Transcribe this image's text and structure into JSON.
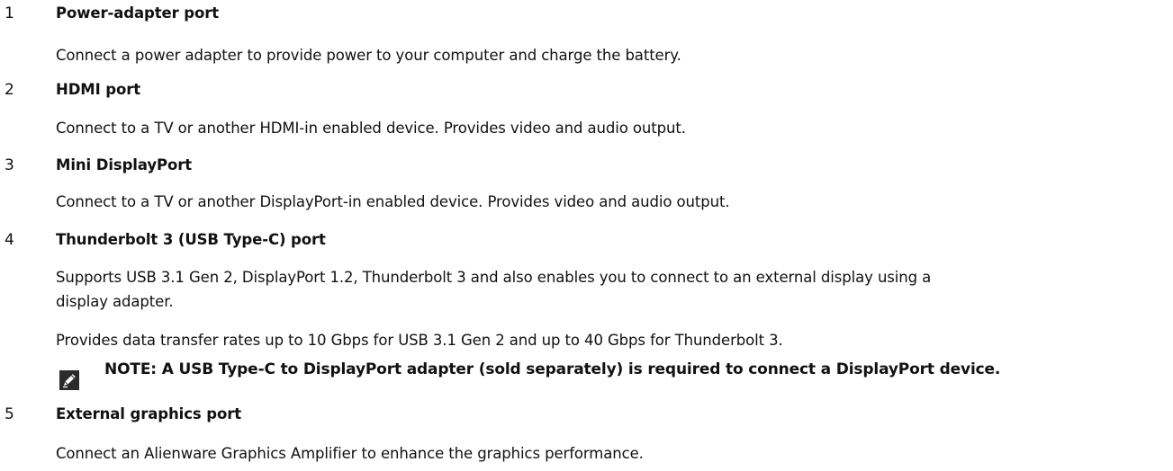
{
  "items": [
    {
      "number": "1",
      "title": "Power-adapter port",
      "paragraphs": [
        "Connect a power adapter to provide power to your computer and charge the battery."
      ]
    },
    {
      "number": "2",
      "title": "HDMI port",
      "paragraphs": [
        "Connect to a TV or another HDMI-in enabled device. Provides video and audio output."
      ]
    },
    {
      "number": "3",
      "title": "Mini DisplayPort",
      "paragraphs": [
        "Connect to a TV or another DisplayPort-in enabled device. Provides video and audio output."
      ]
    },
    {
      "number": "4",
      "title": "Thunderbolt 3 (USB Type-C) port",
      "paragraphs": [
        "Supports USB 3.1 Gen 2, DisplayPort 1.2, Thunderbolt 3 and also enables you to connect to an external display using a",
        "display adapter.",
        "Provides data transfer rates up to 10 Gbps for USB 3.1 Gen 2 and up to 40 Gbps for Thunderbolt 3."
      ],
      "note": {
        "icon": "pencil-note-icon",
        "text": "NOTE: A USB Type-C to DisplayPort adapter (sold separately) is required to connect a DisplayPort device."
      }
    },
    {
      "number": "5",
      "title": "External graphics port",
      "paragraphs": [
        "Connect an Alienware Graphics Amplifier to enhance the graphics performance."
      ]
    }
  ]
}
